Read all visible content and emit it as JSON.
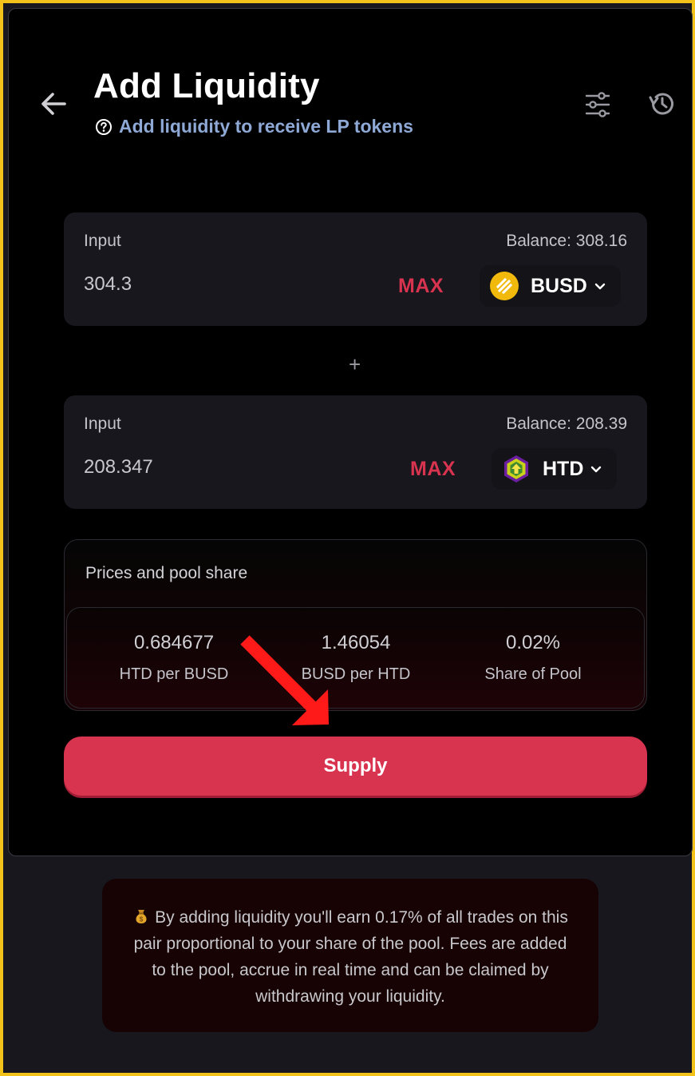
{
  "header": {
    "title": "Add Liquidity",
    "subtitle": "Add liquidity to receive LP tokens",
    "icons": [
      "arrow-left-icon",
      "question-circle-icon",
      "sliders-icon",
      "history-icon"
    ]
  },
  "inputs": [
    {
      "label": "Input",
      "balance": "Balance: 308.16",
      "value": "304.3",
      "max_label": "MAX",
      "token": {
        "symbol": "BUSD",
        "icon": "busd-token-icon",
        "color": "#f0b90b"
      }
    },
    {
      "label": "Input",
      "balance": "Balance: 208.39",
      "value": "208.347",
      "max_label": "MAX",
      "token": {
        "symbol": "HTD",
        "icon": "htd-token-icon",
        "color": "#c8d21a"
      }
    }
  ],
  "plus_sign": "+",
  "prices": {
    "title": "Prices and pool share",
    "stats": [
      {
        "value": "0.684677",
        "caption": "HTD per BUSD"
      },
      {
        "value": "1.46054",
        "caption": "BUSD per HTD"
      },
      {
        "value": "0.02%",
        "caption": "Share of Pool"
      }
    ]
  },
  "supply_label": "Supply",
  "info": {
    "icon": "money-bag-icon",
    "text": "By adding liquidity you'll earn 0.17% of all trades on this pair proportional to your share of the pool. Fees are added to the pool, accrue in real time and can be claimed by withdrawing your liquidity."
  },
  "colors": {
    "accent": "#d8334f",
    "frame_border": "#f3c21a",
    "subtitle": "#8fa9d6",
    "annotation_arrow": "#ff1a1a"
  }
}
